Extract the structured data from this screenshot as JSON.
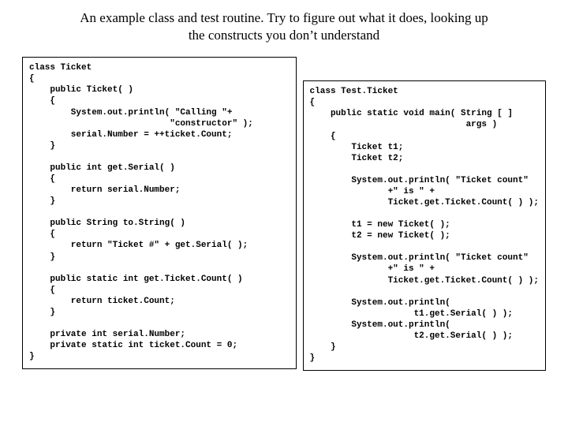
{
  "heading": {
    "line1": "An example class and test routine. Try to figure out what it does, looking up",
    "line2": "the constructs you don’t understand"
  },
  "code_left": "class Ticket\n{\n    public Ticket( )\n    {\n        System.out.println( \"Calling \"+\n                           \"constructor\" );\n        serial.Number = ++ticket.Count;\n    }\n\n    public int get.Serial( )\n    {\n        return serial.Number;\n    }\n\n    public String to.String( )\n    {\n        return \"Ticket #\" + get.Serial( );\n    }\n\n    public static int get.Ticket.Count( )\n    {\n        return ticket.Count;\n    }\n\n    private int serial.Number;\n    private static int ticket.Count = 0;\n}",
  "code_right": "class Test.Ticket\n{\n    public static void main( String [ ]\n                              args )\n    {\n        Ticket t1;\n        Ticket t2;\n\n        System.out.println( \"Ticket count\"\n               +\" is \" +\n               Ticket.get.Ticket.Count( ) );\n\n        t1 = new Ticket( );\n        t2 = new Ticket( );\n\n        System.out.println( \"Ticket count\"\n               +\" is \" +\n               Ticket.get.Ticket.Count( ) );\n\n        System.out.println(\n                    t1.get.Serial( ) );\n        System.out.println(\n                    t2.get.Serial( ) );\n    }\n}"
}
